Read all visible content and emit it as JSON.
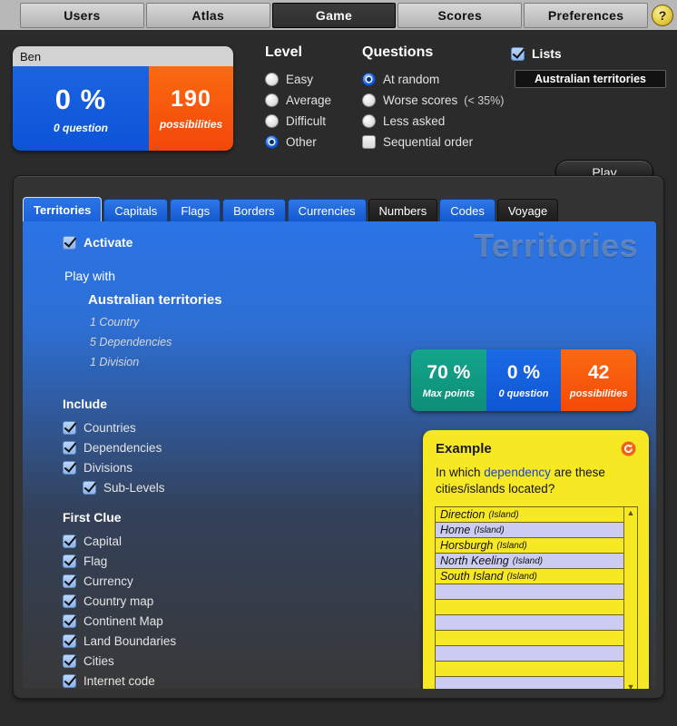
{
  "topbar": {
    "tabs": [
      {
        "label": "Users",
        "active": false
      },
      {
        "label": "Atlas",
        "active": false
      },
      {
        "label": "Game",
        "active": true
      },
      {
        "label": "Scores",
        "active": false
      },
      {
        "label": "Preferences",
        "active": false
      }
    ],
    "help_label": "?"
  },
  "scorecard": {
    "user_name": "Ben",
    "percent": "0 %",
    "percent_sub": "0 question",
    "count": "190",
    "count_sub": "possibilities"
  },
  "level": {
    "title": "Level",
    "options": [
      {
        "label": "Easy",
        "selected": false
      },
      {
        "label": "Average",
        "selected": false
      },
      {
        "label": "Difficult",
        "selected": false
      },
      {
        "label": "Other",
        "selected": true
      }
    ]
  },
  "questions": {
    "title": "Questions",
    "options": [
      {
        "label": "At random",
        "selected": true,
        "note": ""
      },
      {
        "label": "Worse scores",
        "selected": false,
        "note": "(< 35%)"
      },
      {
        "label": "Less asked",
        "selected": false,
        "note": ""
      }
    ],
    "sequential": {
      "label": "Sequential order",
      "checked": false
    }
  },
  "lists": {
    "label": "Lists",
    "checked": true,
    "selected_list": "Australian territories",
    "play_label": "Play"
  },
  "panel": {
    "tabs": [
      {
        "label": "Territories",
        "state": "active"
      },
      {
        "label": "Capitals",
        "state": "blue"
      },
      {
        "label": "Flags",
        "state": "blue"
      },
      {
        "label": "Borders",
        "state": "blue"
      },
      {
        "label": "Currencies",
        "state": "blue"
      },
      {
        "label": "Numbers",
        "state": "dark"
      },
      {
        "label": "Codes",
        "state": "blue"
      },
      {
        "label": "Voyage",
        "state": "dark"
      }
    ],
    "activate": {
      "label": "Activate",
      "checked": true
    },
    "watermark": "Territories",
    "play_with_label": "Play with",
    "play_with_name": "Australian territories",
    "play_with_lines": [
      "1 Country",
      "5 Dependencies",
      "1 Division"
    ],
    "stats": [
      {
        "value": "70 %",
        "sub": "Max points",
        "color": "#0d8e78"
      },
      {
        "value": "0 %",
        "sub": "0 question",
        "color": "#0f56d4"
      },
      {
        "value": "42",
        "sub": "possibilities",
        "color": "#f44a09"
      }
    ],
    "include": {
      "title": "Include",
      "items": [
        {
          "label": "Countries",
          "checked": true,
          "indent": false
        },
        {
          "label": "Dependencies",
          "checked": true,
          "indent": false
        },
        {
          "label": "Divisions",
          "checked": true,
          "indent": false
        },
        {
          "label": "Sub-Levels",
          "checked": true,
          "indent": true
        }
      ]
    },
    "first_clue": {
      "title": "First Clue",
      "items": [
        {
          "label": "Capital",
          "checked": true
        },
        {
          "label": "Flag",
          "checked": true
        },
        {
          "label": "Currency",
          "checked": true
        },
        {
          "label": "Country map",
          "checked": true
        },
        {
          "label": "Continent Map",
          "checked": true
        },
        {
          "label": "Land Boundaries",
          "checked": true
        },
        {
          "label": "Cities",
          "checked": true
        },
        {
          "label": "Internet code",
          "checked": true
        }
      ]
    },
    "example": {
      "title": "Example",
      "refresh_icon": "refresh-icon",
      "question_prefix": "In which ",
      "question_keyword": "dependency",
      "question_suffix": " are these cities/islands located?",
      "rows": [
        {
          "name": "Direction",
          "kind": "(Island)"
        },
        {
          "name": "Home",
          "kind": "(Island)"
        },
        {
          "name": "Horsburgh",
          "kind": "(Island)"
        },
        {
          "name": "North Keeling",
          "kind": "(Island)"
        },
        {
          "name": "South Island",
          "kind": "(Island)"
        },
        {
          "name": "",
          "kind": ""
        },
        {
          "name": "",
          "kind": ""
        },
        {
          "name": "",
          "kind": ""
        },
        {
          "name": "",
          "kind": ""
        },
        {
          "name": "",
          "kind": ""
        },
        {
          "name": "",
          "kind": ""
        },
        {
          "name": "",
          "kind": ""
        }
      ],
      "scroll_up": "▲",
      "scroll_down": "▼"
    }
  }
}
